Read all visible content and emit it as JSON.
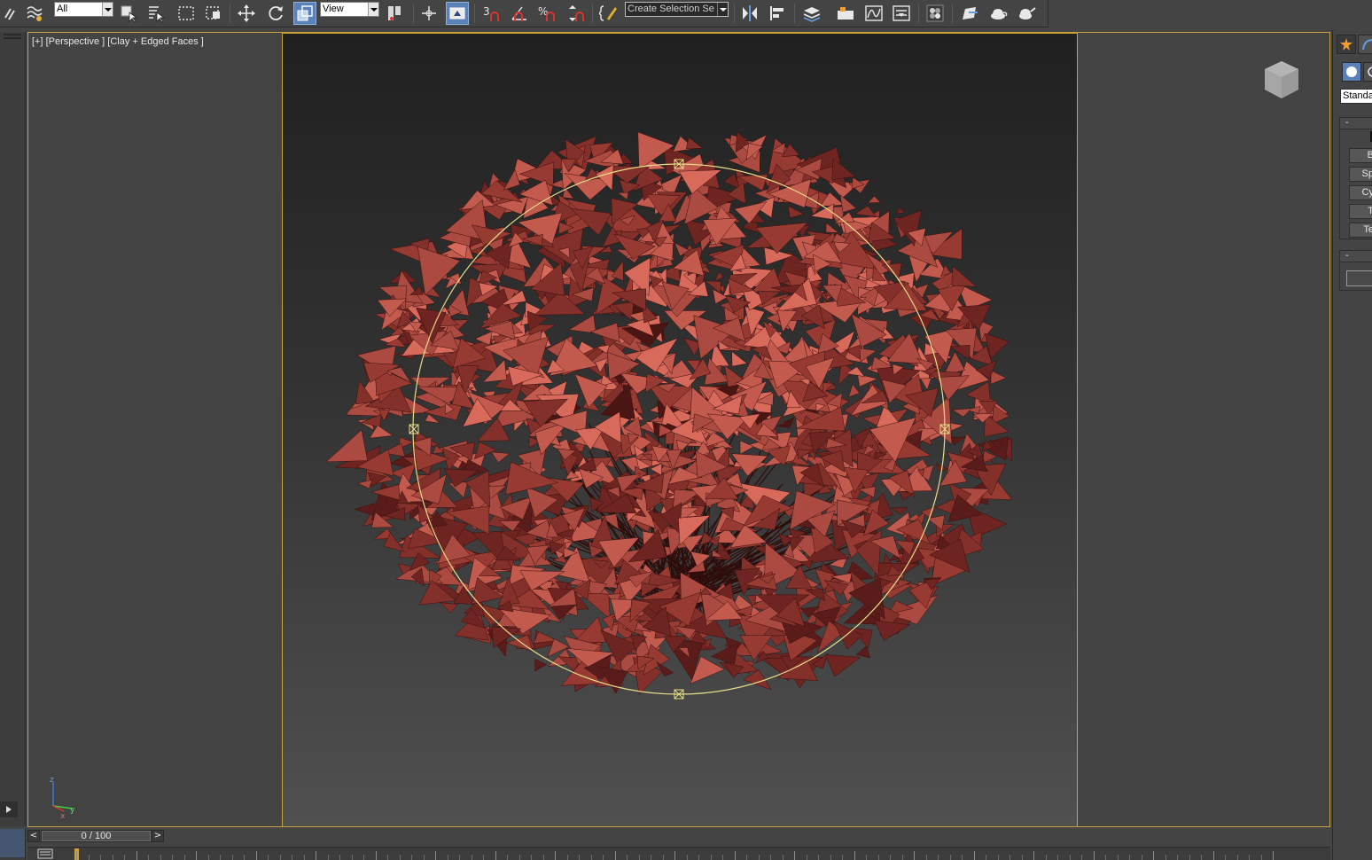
{
  "toolbar": {
    "selection_filter": "All",
    "reference_coordinate": "View",
    "named_selection_placeholder": "Create Selection Se",
    "snap_angle_label": "3",
    "percent_snap_label": "%"
  },
  "viewport": {
    "label": "[+] [Perspective ] [Clay + Edged Faces ]",
    "gizmo_axes": [
      "z",
      "x",
      "y"
    ]
  },
  "command_panel": {
    "object_type_combo": "Standa",
    "object_buttons": [
      "B",
      "Sp",
      "Cy",
      "T",
      "Te"
    ],
    "rollout_collapse": "-",
    "rollout2_collapse": "-"
  },
  "timeline": {
    "frame_display": "0 / 100",
    "prev_label": "<",
    "next_label": ">"
  },
  "colors": {
    "accent_border": "#c9a33b",
    "foliage": "#9a3a34",
    "selection_circle": "#e8dc8a",
    "active_tool": "#5a82b8"
  }
}
